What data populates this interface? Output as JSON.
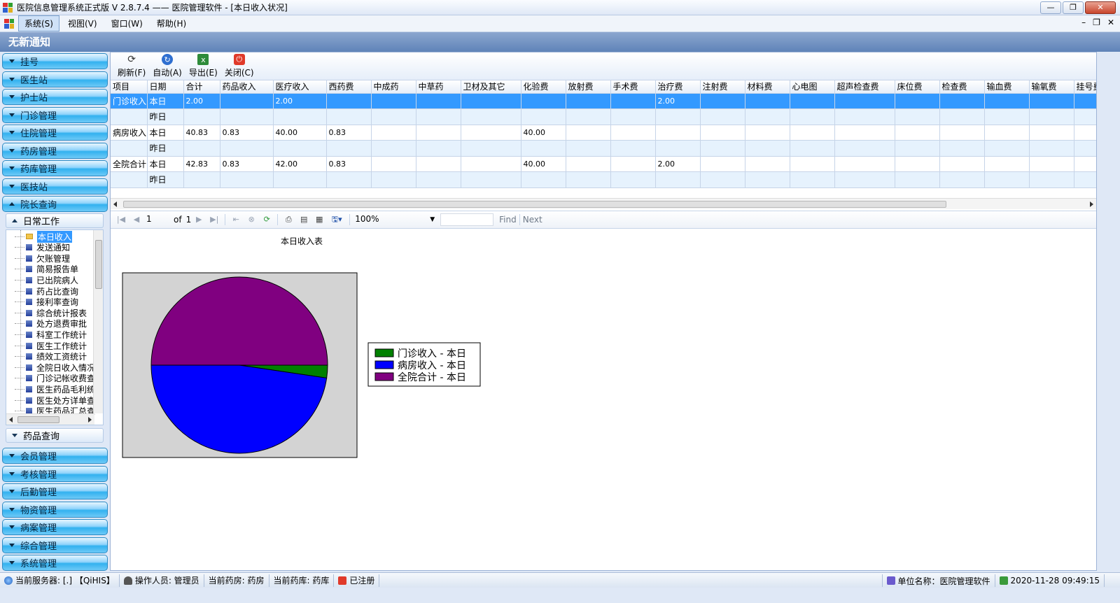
{
  "window": {
    "title": "医院信息管理系统正式版 V 2.8.7.4 —— 医院管理软件 - [本日收入状况]",
    "min": "—",
    "max": "❐",
    "close": "✕"
  },
  "menu": {
    "items": [
      "系统(S)",
      "视图(V)",
      "窗口(W)",
      "帮助(H)"
    ],
    "mdi_min": "–",
    "mdi_restore": "❐",
    "mdi_close": "✕"
  },
  "notice": "无新通知",
  "sidebar": {
    "top_modules": [
      "挂号",
      "医生站",
      "护士站",
      "门诊管理",
      "住院管理",
      "药房管理",
      "药库管理",
      "医技站",
      "院长查询"
    ],
    "sub_header": "日常工作",
    "tree_items": [
      "本日收入",
      "发送通知",
      "欠账管理",
      "简易报告单",
      "已出院病人",
      "药占比查询",
      "接利率查询",
      "综合统计报表",
      "处方退费审批",
      "科室工作统计",
      "医生工作统计",
      "绩效工资统计",
      "全院日收入情况",
      "门诊记帐收费查",
      "医生药品毛利统",
      "医生处方详单查",
      "医生药品汇总查"
    ],
    "tree_selected": 0,
    "sub_header2": "药品查询",
    "bottom_modules": [
      "会员管理",
      "考核管理",
      "后勤管理",
      "物资管理",
      "病案管理",
      "综合管理",
      "系统管理"
    ]
  },
  "toolbar": {
    "refresh": "刷新(F)",
    "auto": "自动(A)",
    "export": "导出(E)",
    "close": "关闭(C)"
  },
  "grid": {
    "columns": [
      "项目",
      "日期",
      "合计",
      "药品收入",
      "医疗收入",
      "西药费",
      "中成药",
      "中草药",
      "卫材及其它",
      "化验费",
      "放射费",
      "手术费",
      "治疗费",
      "注射费",
      "材料费",
      "心电图",
      "超声检查费",
      "床位费",
      "检查费",
      "输血费",
      "输氧费",
      "挂号费"
    ],
    "rows": [
      [
        "门诊收入",
        "本日",
        "2.00",
        "",
        "2.00",
        "",
        "",
        "",
        "",
        "",
        "",
        "",
        "2.00",
        "",
        "",
        "",
        "",
        "",
        "",
        "",
        "",
        ""
      ],
      [
        "",
        "昨日",
        "",
        "",
        "",
        "",
        "",
        "",
        "",
        "",
        "",
        "",
        "",
        "",
        "",
        "",
        "",
        "",
        "",
        "",
        "",
        ""
      ],
      [
        "病房收入",
        "本日",
        "40.83",
        "0.83",
        "40.00",
        "0.83",
        "",
        "",
        "",
        "40.00",
        "",
        "",
        "",
        "",
        "",
        "",
        "",
        "",
        "",
        "",
        "",
        ""
      ],
      [
        "",
        "昨日",
        "",
        "",
        "",
        "",
        "",
        "",
        "",
        "",
        "",
        "",
        "",
        "",
        "",
        "",
        "",
        "",
        "",
        "",
        "",
        ""
      ],
      [
        "全院合计",
        "本日",
        "42.83",
        "0.83",
        "42.00",
        "0.83",
        "",
        "",
        "",
        "40.00",
        "",
        "",
        "2.00",
        "",
        "",
        "",
        "",
        "",
        "",
        "",
        "",
        ""
      ],
      [
        "",
        "昨日",
        "",
        "",
        "",
        "",
        "",
        "",
        "",
        "",
        "",
        "",
        "",
        "",
        "",
        "",
        "",
        "",
        "",
        "",
        "",
        ""
      ]
    ],
    "selected_row": 0
  },
  "report_toolbar": {
    "page": "1",
    "of_label": "of",
    "total_pages": "1",
    "zoom": "100%",
    "find": "Find",
    "next": "Next"
  },
  "chart_data": {
    "type": "pie",
    "title": "本日收入表",
    "series": [
      {
        "name": "门诊收入 - 本日",
        "value": 2.0,
        "color": "#008000"
      },
      {
        "name": "病房收入 - 本日",
        "value": 40.83,
        "color": "#0000ff"
      },
      {
        "name": "全院合计 - 本日",
        "value": 42.83,
        "color": "#800080"
      }
    ],
    "legend": "right",
    "background": "#d3d3d3"
  },
  "status": {
    "server": "当前服务器: [.]  【QiHIS】",
    "operator": "操作人员: 管理员",
    "pharmacy": "当前药房:  药房",
    "warehouse": "当前药库:  药库",
    "registered": "已注册",
    "unit": "单位名称：医院管理软件",
    "datetime": "2020-11-28 09:49:15"
  }
}
